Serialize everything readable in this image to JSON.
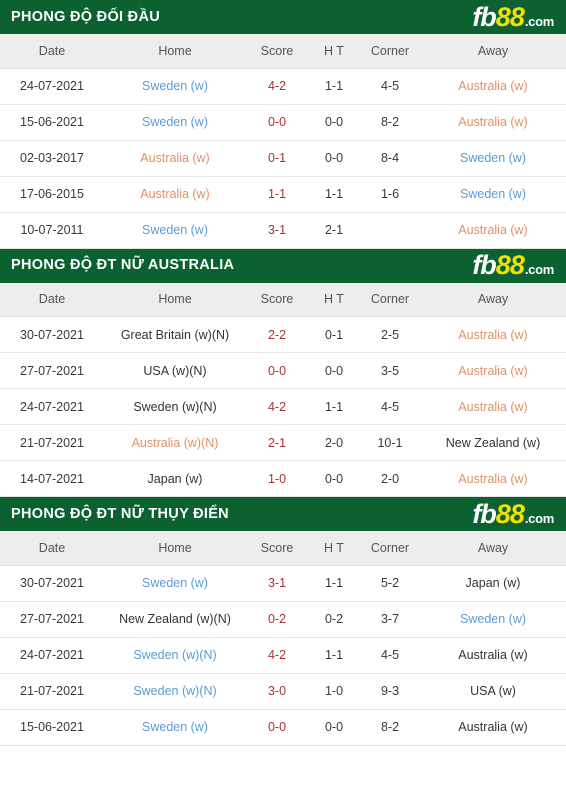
{
  "brand": {
    "fb": "fb",
    "eightyeight": "88",
    "com": ".com"
  },
  "colors": {
    "header_green": "#0b6130",
    "brand_yellow": "#f5e100",
    "team_blue": "#5b9bd5",
    "team_orange": "#e2906a",
    "score_red": "#a83232",
    "header_row_bg": "#ededed"
  },
  "columns": {
    "date": "Date",
    "home": "Home",
    "score": "Score",
    "ht": "H T",
    "corner": "Corner",
    "away": "Away"
  },
  "sections": [
    {
      "title": "PHONG ĐỘ ĐỐI ĐẦU",
      "rows": [
        {
          "date": "24-07-2021",
          "home": "Sweden (w)",
          "home_color": "blue",
          "score": "4-2",
          "ht": "1-1",
          "corner": "4-5",
          "away": "Australia (w)",
          "away_color": "orange"
        },
        {
          "date": "15-06-2021",
          "home": "Sweden (w)",
          "home_color": "blue",
          "score": "0-0",
          "ht": "0-0",
          "corner": "8-2",
          "away": "Australia (w)",
          "away_color": "orange"
        },
        {
          "date": "02-03-2017",
          "home": "Australia (w)",
          "home_color": "orange",
          "score": "0-1",
          "ht": "0-0",
          "corner": "8-4",
          "away": "Sweden (w)",
          "away_color": "blue"
        },
        {
          "date": "17-06-2015",
          "home": "Australia (w)",
          "home_color": "orange",
          "score": "1-1",
          "ht": "1-1",
          "corner": "1-6",
          "away": "Sweden (w)",
          "away_color": "blue"
        },
        {
          "date": "10-07-2011",
          "home": "Sweden (w)",
          "home_color": "blue",
          "score": "3-1",
          "ht": "2-1",
          "corner": "",
          "away": "Australia (w)",
          "away_color": "orange"
        }
      ]
    },
    {
      "title": "PHONG ĐỘ ĐT NỮ AUSTRALIA",
      "rows": [
        {
          "date": "30-07-2021",
          "home": "Great Britain (w)(N)",
          "home_color": "dark",
          "score": "2-2",
          "ht": "0-1",
          "corner": "2-5",
          "away": "Australia (w)",
          "away_color": "orange"
        },
        {
          "date": "27-07-2021",
          "home": "USA (w)(N)",
          "home_color": "dark",
          "score": "0-0",
          "ht": "0-0",
          "corner": "3-5",
          "away": "Australia (w)",
          "away_color": "orange"
        },
        {
          "date": "24-07-2021",
          "home": "Sweden (w)(N)",
          "home_color": "dark",
          "score": "4-2",
          "ht": "1-1",
          "corner": "4-5",
          "away": "Australia (w)",
          "away_color": "orange"
        },
        {
          "date": "21-07-2021",
          "home": "Australia (w)(N)",
          "home_color": "orange",
          "score": "2-1",
          "ht": "2-0",
          "corner": "10-1",
          "away": "New Zealand (w)",
          "away_color": "dark"
        },
        {
          "date": "14-07-2021",
          "home": "Japan (w)",
          "home_color": "dark",
          "score": "1-0",
          "ht": "0-0",
          "corner": "2-0",
          "away": "Australia (w)",
          "away_color": "orange"
        }
      ]
    },
    {
      "title": "PHONG ĐỘ ĐT NỮ THỤY ĐIỂN",
      "rows": [
        {
          "date": "30-07-2021",
          "home": "Sweden (w)",
          "home_color": "blue",
          "score": "3-1",
          "ht": "1-1",
          "corner": "5-2",
          "away": "Japan (w)",
          "away_color": "dark"
        },
        {
          "date": "27-07-2021",
          "home": "New Zealand (w)(N)",
          "home_color": "dark",
          "score": "0-2",
          "ht": "0-2",
          "corner": "3-7",
          "away": "Sweden (w)",
          "away_color": "blue"
        },
        {
          "date": "24-07-2021",
          "home": "Sweden (w)(N)",
          "home_color": "blue",
          "score": "4-2",
          "ht": "1-1",
          "corner": "4-5",
          "away": "Australia (w)",
          "away_color": "dark"
        },
        {
          "date": "21-07-2021",
          "home": "Sweden (w)(N)",
          "home_color": "blue",
          "score": "3-0",
          "ht": "1-0",
          "corner": "9-3",
          "away": "USA (w)",
          "away_color": "dark"
        },
        {
          "date": "15-06-2021",
          "home": "Sweden (w)",
          "home_color": "blue",
          "score": "0-0",
          "ht": "0-0",
          "corner": "8-2",
          "away": "Australia (w)",
          "away_color": "dark"
        }
      ]
    }
  ]
}
